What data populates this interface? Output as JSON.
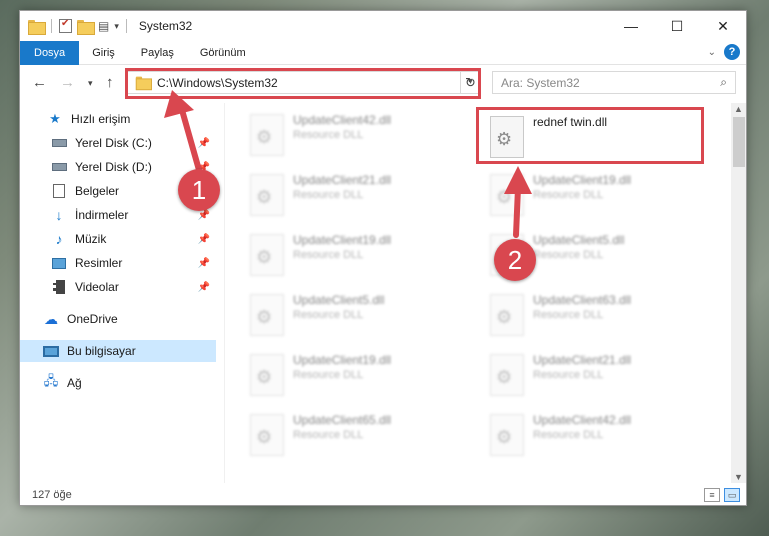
{
  "window": {
    "title": "System32",
    "controls": {
      "minimize": "—",
      "maximize": "☐",
      "close": "✕"
    }
  },
  "ribbon": {
    "tabs": [
      "Dosya",
      "Giriş",
      "Paylaş",
      "Görünüm"
    ],
    "help": "?"
  },
  "address": {
    "path": "C:\\Windows\\System32",
    "search_placeholder": "Ara: System32"
  },
  "sidebar": {
    "items": [
      {
        "label": "Hızlı erişim",
        "icon": "star-icon",
        "pinned": false
      },
      {
        "label": "Yerel Disk (C:)",
        "icon": "drive-icon",
        "pinned": true
      },
      {
        "label": "Yerel Disk (D:)",
        "icon": "drive-icon",
        "pinned": true
      },
      {
        "label": "Belgeler",
        "icon": "documents-icon",
        "pinned": true
      },
      {
        "label": "İndirmeler",
        "icon": "downloads-icon",
        "pinned": true
      },
      {
        "label": "Müzik",
        "icon": "music-icon",
        "pinned": true
      },
      {
        "label": "Resimler",
        "icon": "pictures-icon",
        "pinned": true
      },
      {
        "label": "Videolar",
        "icon": "videos-icon",
        "pinned": true
      },
      {
        "label": "OneDrive",
        "icon": "onedrive-icon",
        "pinned": false
      },
      {
        "label": "Bu bilgisayar",
        "icon": "this-pc-icon",
        "pinned": false,
        "selected": true
      },
      {
        "label": "Ağ",
        "icon": "network-icon",
        "pinned": false
      }
    ]
  },
  "files": {
    "left": [
      {
        "name": "UpdateClient42.dll",
        "type": "Resource DLL"
      },
      {
        "name": "UpdateClient21.dll",
        "type": "Resource DLL"
      },
      {
        "name": "UpdateClient19.dll",
        "type": "Resource DLL"
      },
      {
        "name": "UpdateClient5.dll",
        "type": "Resource DLL"
      },
      {
        "name": "UpdateClient19.dll",
        "type": "Resource DLL"
      },
      {
        "name": "UpdateClient65.dll",
        "type": "Resource DLL"
      }
    ],
    "right": [
      {
        "name": "rednef twin.dll",
        "type": ""
      },
      {
        "name": "UpdateClient19.dll",
        "type": "Resource DLL"
      },
      {
        "name": "UpdateClient5.dll",
        "type": "Resource DLL"
      },
      {
        "name": "UpdateClient63.dll",
        "type": "Resource DLL"
      },
      {
        "name": "UpdateClient21.dll",
        "type": "Resource DLL"
      },
      {
        "name": "UpdateClient42.dll",
        "type": "Resource DLL"
      }
    ]
  },
  "status": {
    "count": "127 öğe"
  },
  "annotations": {
    "step1": "1",
    "step2": "2",
    "color": "#d9474f"
  }
}
